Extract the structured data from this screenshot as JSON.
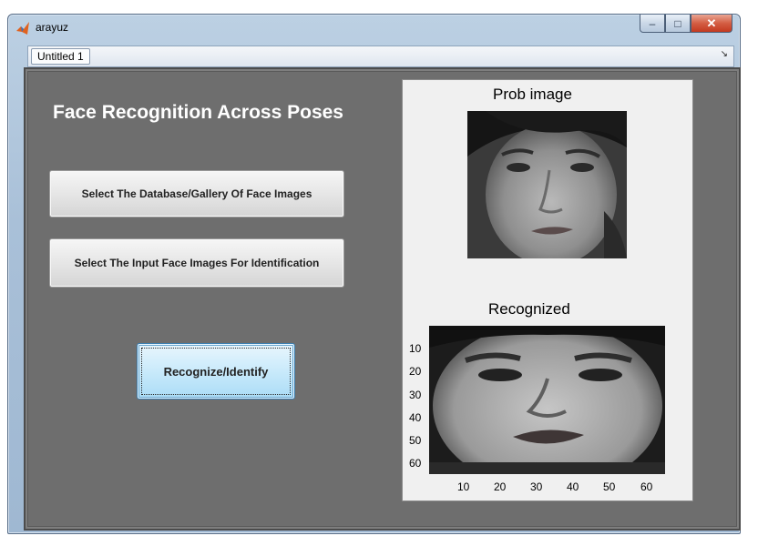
{
  "window": {
    "title": "arayuz",
    "minimize_glyph": "–",
    "maximize_glyph": "□",
    "close_glyph": "✕"
  },
  "tabs": [
    {
      "label": "Untitled 1"
    }
  ],
  "dock_arrow_glyph": "↘",
  "figure": {
    "title": "Face Recognition Across Poses",
    "buttons": {
      "select_database": "Select The Database/Gallery Of Face Images",
      "select_input": "Select The Input Face Images For Identification",
      "recognize": "Recognize/Identify"
    }
  },
  "axes": {
    "probe": {
      "title": "Prob image"
    },
    "recognized": {
      "title": "Recognized",
      "yticks": [
        "10",
        "20",
        "30",
        "40",
        "50",
        "60"
      ],
      "xticks": [
        "10",
        "20",
        "30",
        "40",
        "50",
        "60"
      ]
    }
  },
  "colors": {
    "figure_background": "#6e6e6e",
    "axes_panel_background": "#f0f0f0",
    "highlight_button": "#c9eafb",
    "title_text": "#ffffff"
  },
  "icons": {
    "app": "matlab-logo-icon"
  }
}
